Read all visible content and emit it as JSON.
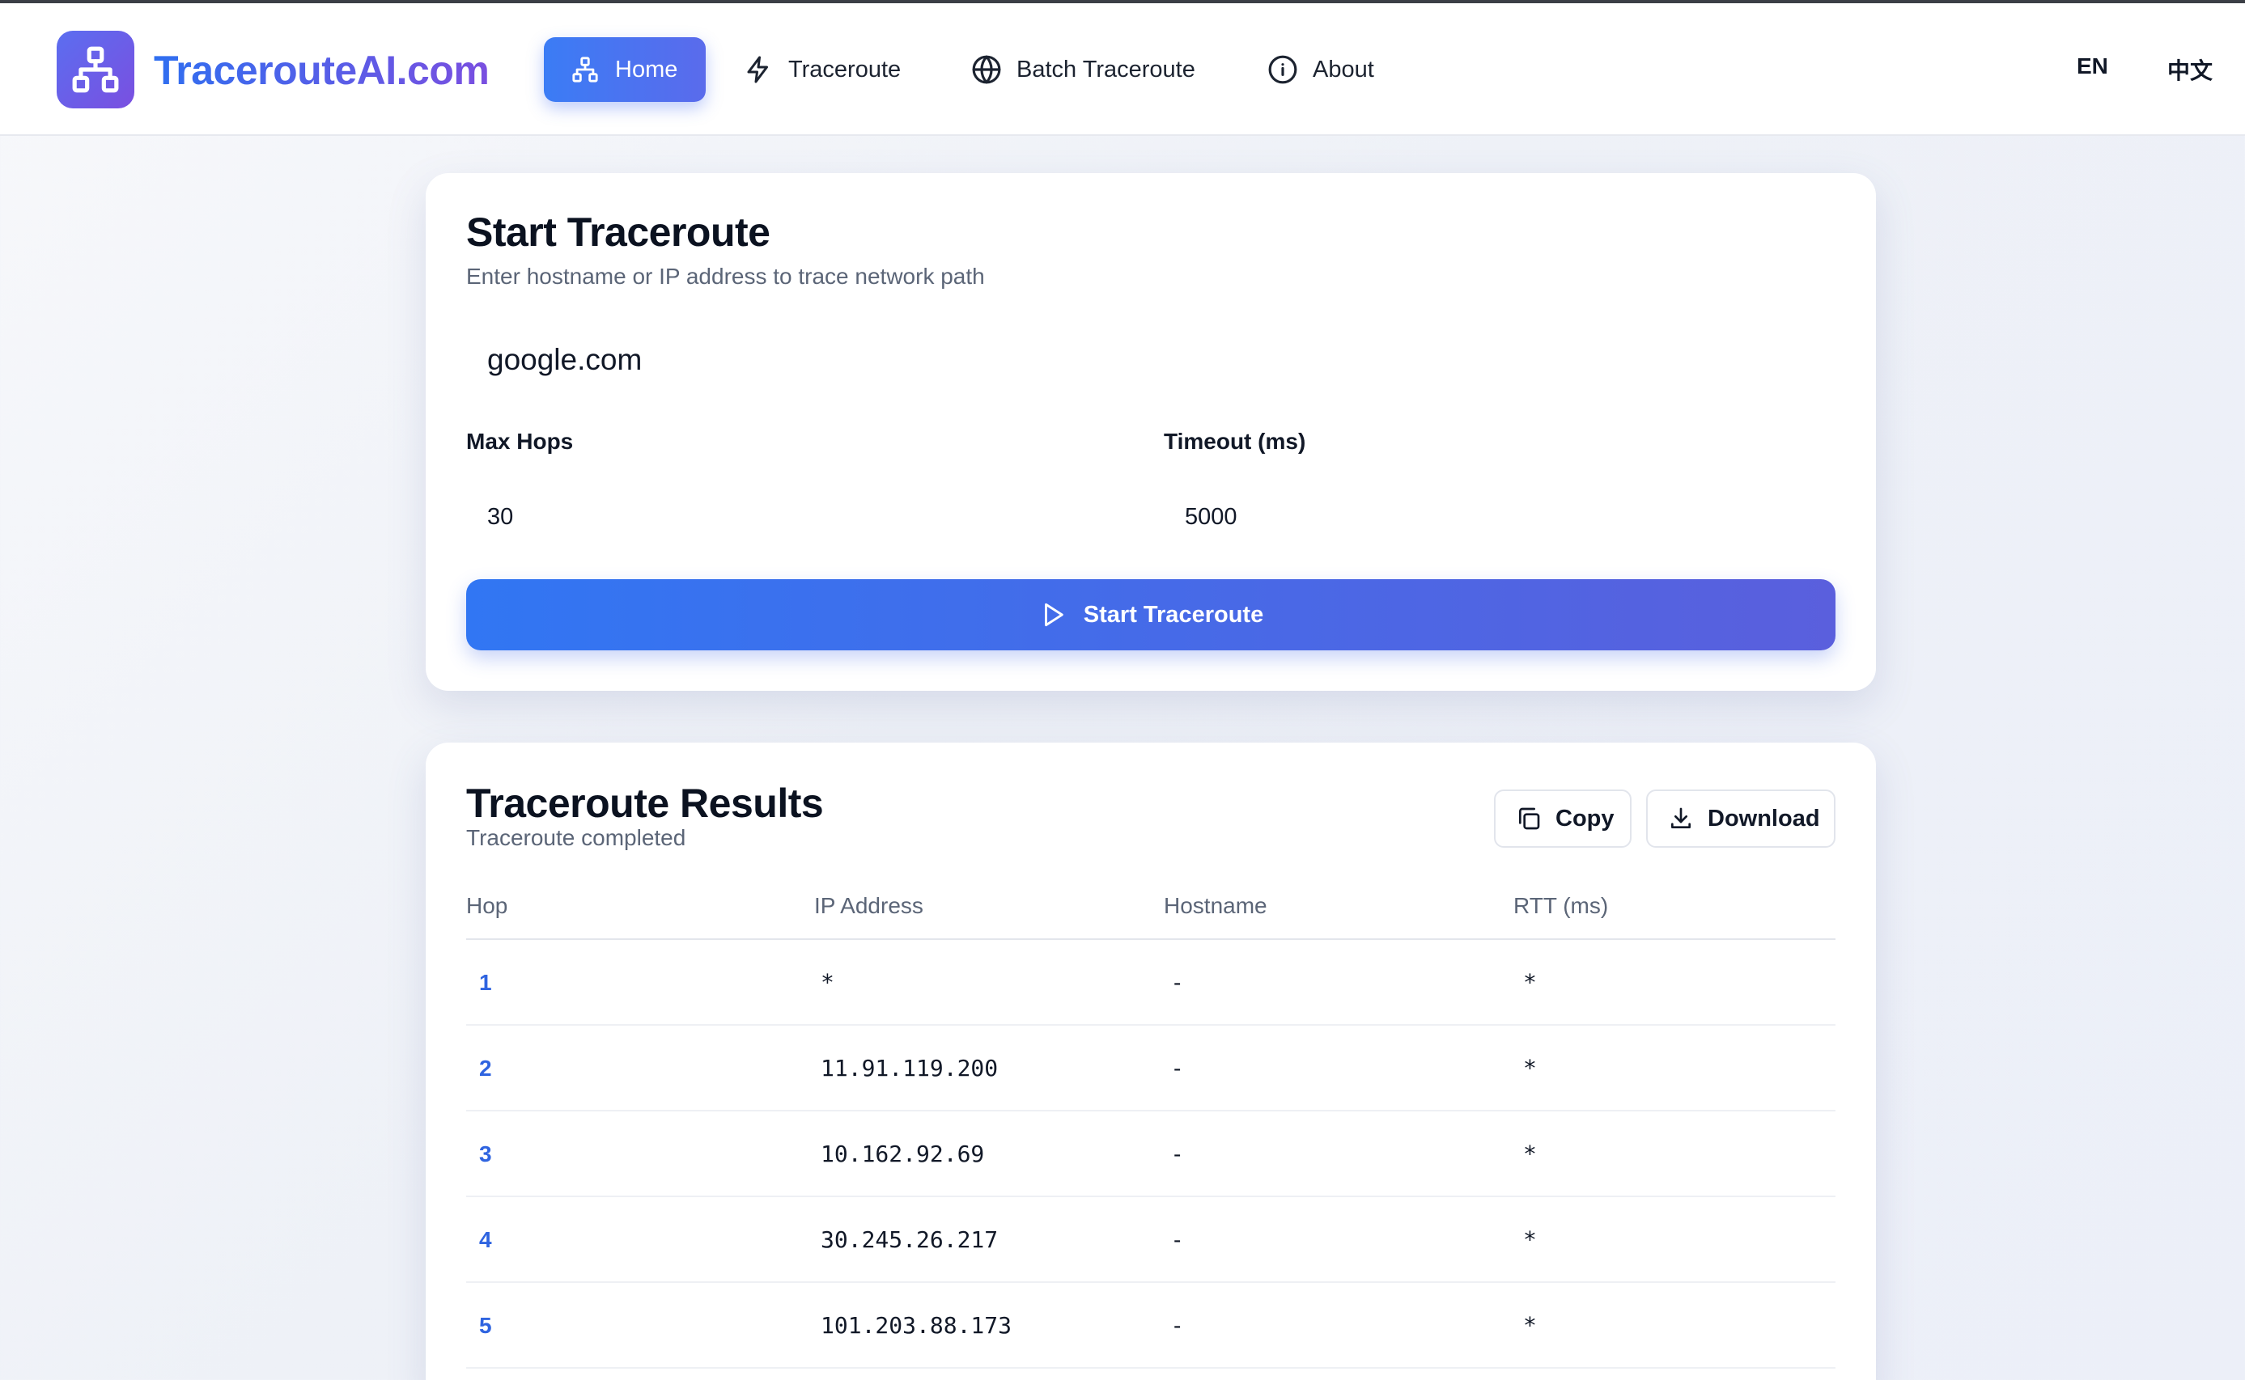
{
  "header": {
    "brand": "TracerouteAI.com",
    "nav": [
      {
        "label": "Home",
        "icon": "network-icon",
        "active": true
      },
      {
        "label": "Traceroute",
        "icon": "lightning-icon"
      },
      {
        "label": "Batch Traceroute",
        "icon": "globe-icon"
      },
      {
        "label": "About",
        "icon": "info-icon"
      }
    ],
    "languages": [
      "EN",
      "中文"
    ]
  },
  "start_card": {
    "title": "Start Traceroute",
    "subtitle": "Enter hostname or IP address to trace network path",
    "host_value": "google.com",
    "max_hops_label": "Max Hops",
    "max_hops_value": "30",
    "timeout_label": "Timeout (ms)",
    "timeout_value": "5000",
    "start_button": "Start Traceroute"
  },
  "results": {
    "title": "Traceroute Results",
    "status": "Traceroute completed",
    "copy_label": "Copy",
    "download_label": "Download",
    "columns": [
      "Hop",
      "IP Address",
      "Hostname",
      "RTT (ms)"
    ],
    "rows": [
      {
        "hop": "1",
        "ip": "*",
        "hostname": "-",
        "rtt": "*"
      },
      {
        "hop": "2",
        "ip": "11.91.119.200",
        "hostname": "-",
        "rtt": "*"
      },
      {
        "hop": "3",
        "ip": "10.162.92.69",
        "hostname": "-",
        "rtt": "*"
      },
      {
        "hop": "4",
        "ip": "30.245.26.217",
        "hostname": "-",
        "rtt": "*"
      },
      {
        "hop": "5",
        "ip": "101.203.88.173",
        "hostname": "-",
        "rtt": "*"
      }
    ]
  },
  "colors": {
    "primary": "#3176f3",
    "accent": "#7a4fe0",
    "hop_link": "#2f64e0"
  }
}
